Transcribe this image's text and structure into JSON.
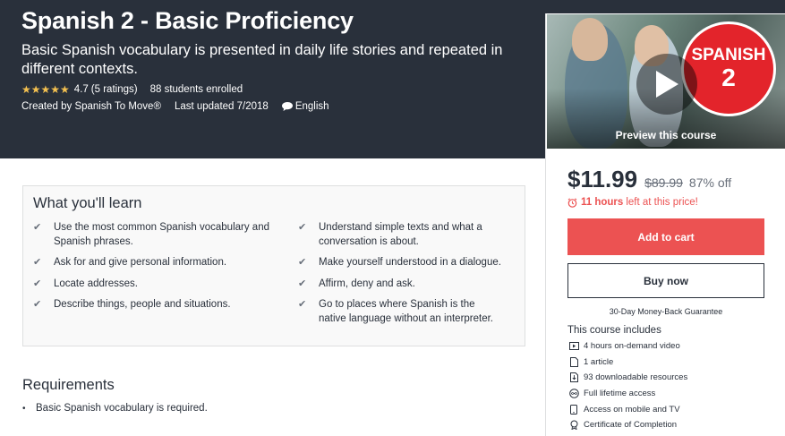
{
  "header": {
    "title": "Spanish 2 - Basic Proficiency",
    "subtitle": "Basic Spanish vocabulary is presented in daily life stories and repeated in different contexts.",
    "stars": "★★★★★",
    "rating": "4.7",
    "ratings_count": "(5 ratings)",
    "students": "88 students enrolled",
    "created_by": "Created by Spanish To Move®",
    "last_updated": "Last updated 7/2018",
    "language": "English"
  },
  "preview": {
    "logo_line1": "SPANISH",
    "logo_line2": "2",
    "label": "Preview this course"
  },
  "purchase": {
    "price": "$11.99",
    "original_price": "$89.99",
    "discount": "87% off",
    "timer_hours": "11 hours",
    "timer_text": "left at this price!",
    "add_to_cart": "Add to cart",
    "buy_now": "Buy now",
    "guarantee": "30-Day Money-Back Guarantee",
    "accent_color": "#ec5252"
  },
  "includes": {
    "title": "This course includes",
    "items": [
      {
        "icon": "video-icon",
        "text": "4 hours on-demand video"
      },
      {
        "icon": "article-icon",
        "text": "1 article"
      },
      {
        "icon": "download-icon",
        "text": "93 downloadable resources"
      },
      {
        "icon": "infinity-icon",
        "text": "Full lifetime access"
      },
      {
        "icon": "mobile-icon",
        "text": "Access on mobile and TV"
      },
      {
        "icon": "certificate-icon",
        "text": "Certificate of Completion"
      }
    ]
  },
  "learn": {
    "title": "What you'll learn",
    "items": [
      "Use the most common Spanish vocabulary and Spanish phrases.",
      "Understand simple texts and what a conversation is about.",
      "Ask for and give personal information.",
      "Make yourself understood in a dialogue.",
      "Locate addresses.",
      "Affirm, deny and ask.",
      "Describe things, people and situations.",
      "Go to places where Spanish is the native language without an interpreter."
    ]
  },
  "requirements": {
    "title": "Requirements",
    "items": [
      "Basic Spanish vocabulary is required."
    ]
  }
}
